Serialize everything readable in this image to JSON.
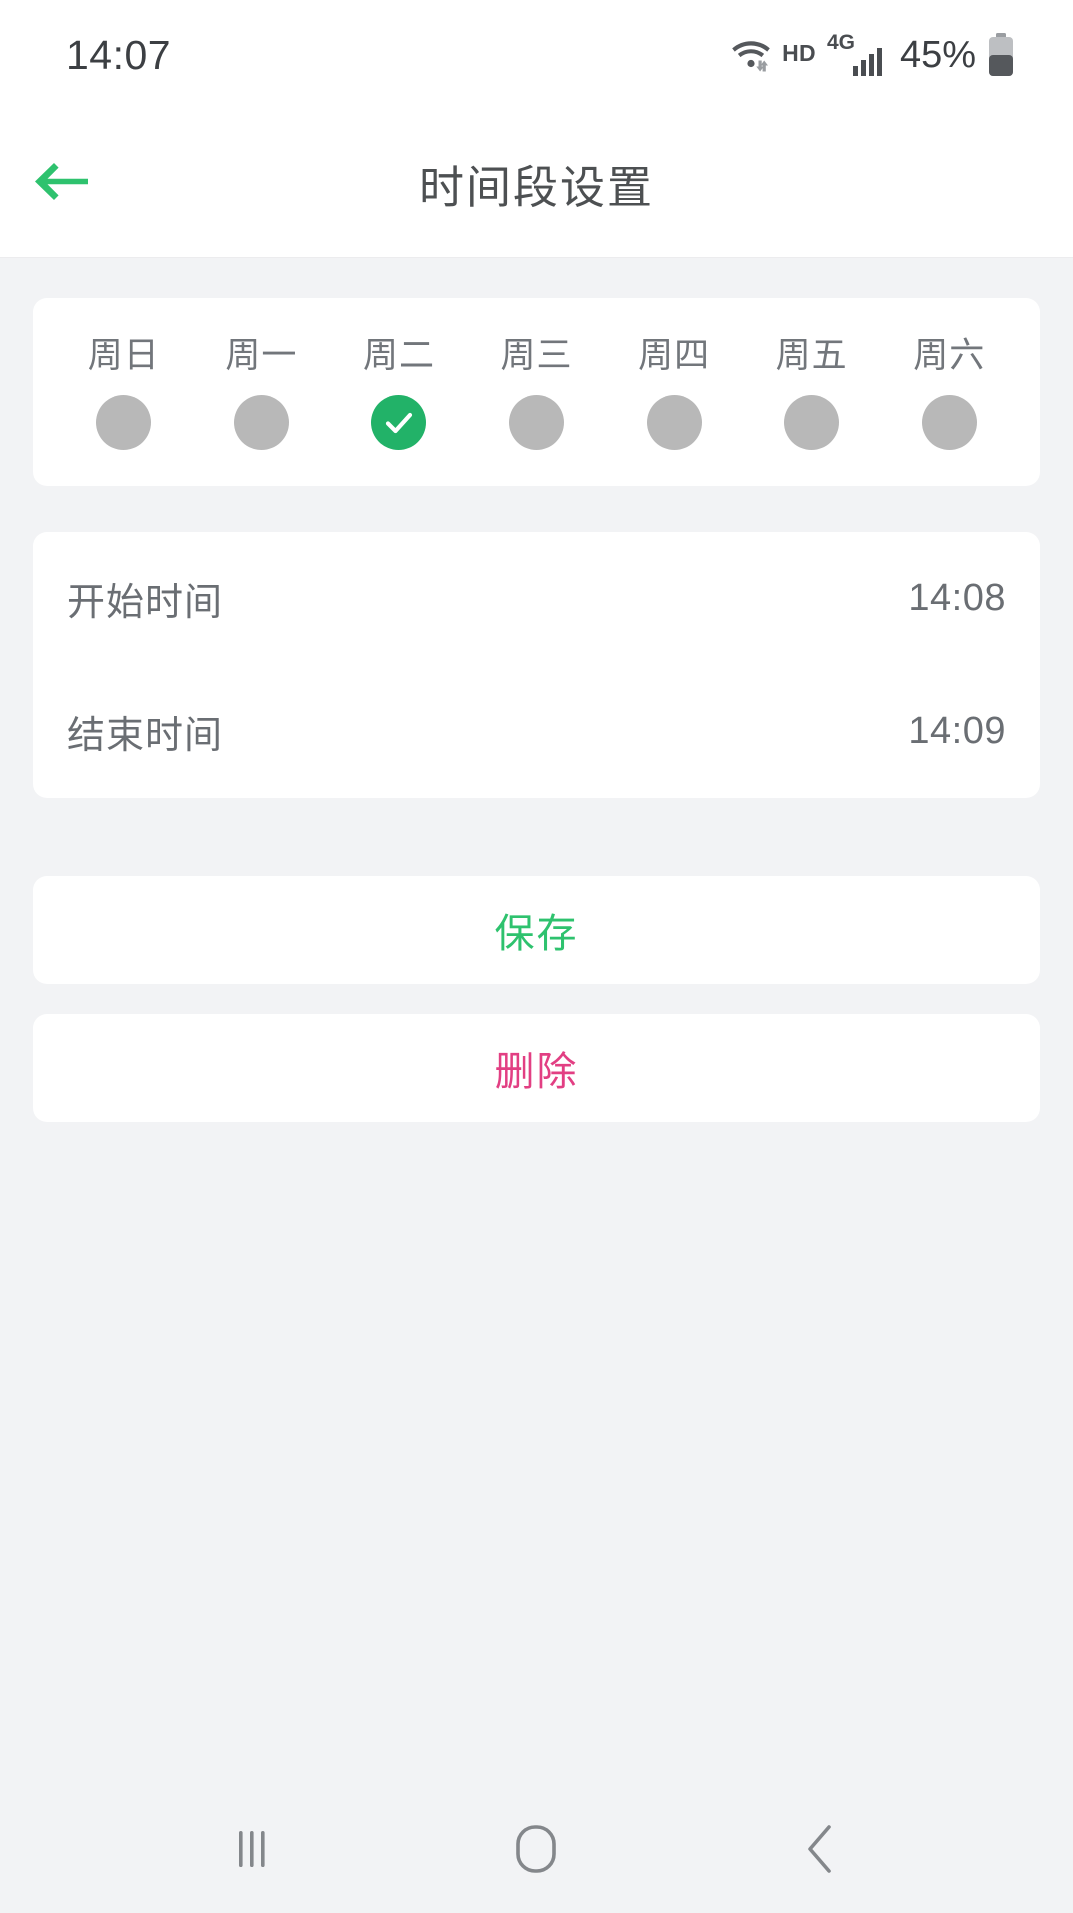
{
  "status_bar": {
    "clock": "14:07",
    "wifi_icon": "wifi-icon",
    "data_transfer_icon": "data-transfer-arrows-icon",
    "hd_label": "HD",
    "network_label": "4G",
    "signal_icon": "cellular-signal-icon",
    "battery_percent": "45%",
    "battery_icon": "battery-icon"
  },
  "header": {
    "back_icon": "arrow-left-icon",
    "title": "时间段设置"
  },
  "week_selector": {
    "days": [
      {
        "label": "周日",
        "selected": false
      },
      {
        "label": "周一",
        "selected": false
      },
      {
        "label": "周二",
        "selected": true
      },
      {
        "label": "周三",
        "selected": false
      },
      {
        "label": "周四",
        "selected": false
      },
      {
        "label": "周五",
        "selected": false
      },
      {
        "label": "周六",
        "selected": false
      }
    ],
    "check_icon": "check-icon",
    "selected_color": "#22b268",
    "unselected_color": "#b8b8b8"
  },
  "time_settings": {
    "start": {
      "label": "开始时间",
      "value": "14:08"
    },
    "end": {
      "label": "结束时间",
      "value": "14:09"
    }
  },
  "actions": {
    "save": {
      "label": "保存",
      "color": "#2ec26e"
    },
    "delete": {
      "label": "删除",
      "color": "#e23f83"
    }
  },
  "nav_bar": {
    "recents_icon": "recents-icon",
    "home_icon": "home-icon",
    "back_icon": "chevron-left-icon"
  }
}
